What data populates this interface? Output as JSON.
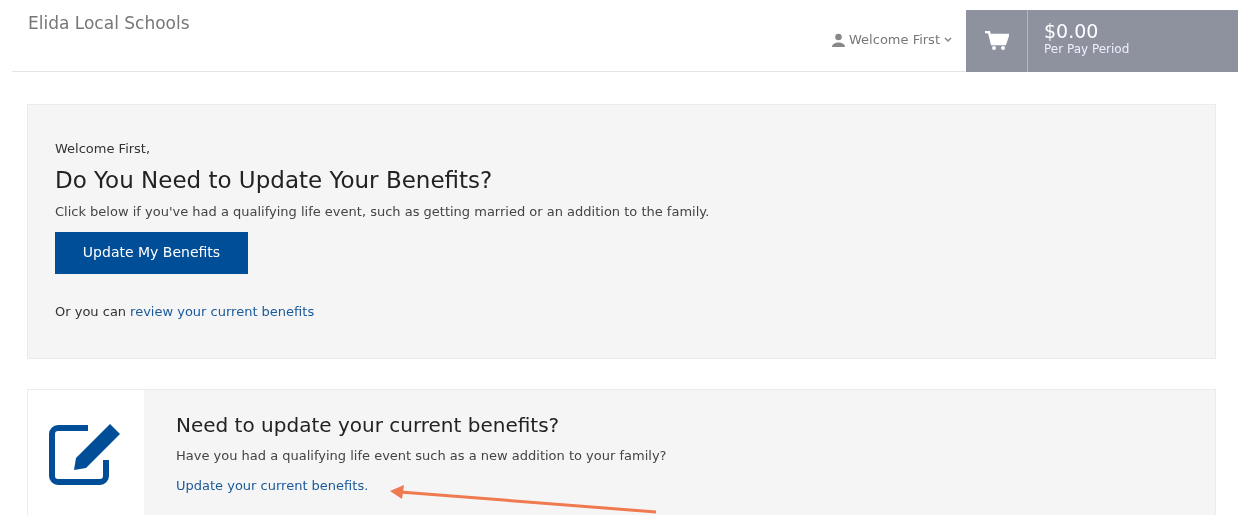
{
  "header": {
    "title": "Elida Local Schools",
    "user_menu": "Welcome First",
    "cart": {
      "amount": "$0.00",
      "period": "Per Pay Period"
    }
  },
  "welcome_panel": {
    "greeting": "Welcome First,",
    "heading": "Do You Need to Update Your Benefits?",
    "description": "Click below if you've had a qualifying life event, such as getting married or an addition to the family.",
    "button": "Update My Benefits",
    "review_prefix": "Or you can",
    "review_link": "review your current benefits"
  },
  "update_card": {
    "heading": "Need to update your current benefits?",
    "description": "Have you had a qualifying life event such as a new addition to your family?",
    "link": "Update your current benefits."
  }
}
